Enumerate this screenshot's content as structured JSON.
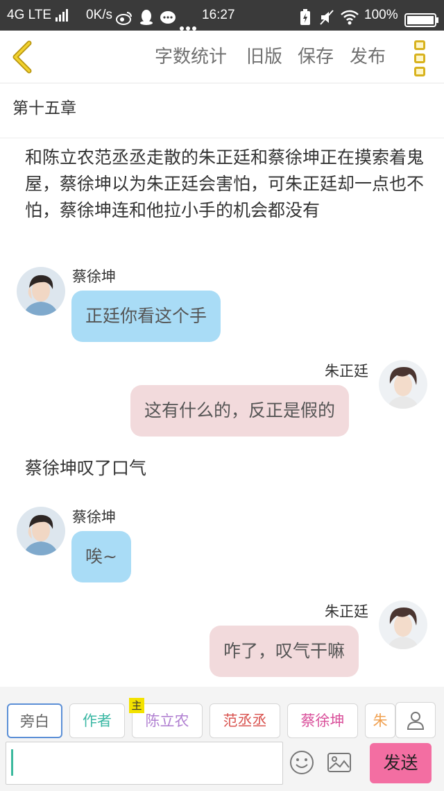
{
  "status_bar": {
    "network": "4G LTE",
    "speed": "0K/s",
    "time": "16:27",
    "battery": "100%",
    "icons": [
      "signal-icon",
      "weibo-icon",
      "qq-icon",
      "message-icon",
      "more-dots-icon",
      "charging-icon",
      "mute-icon",
      "wifi-icon",
      "battery-icon"
    ]
  },
  "nav": {
    "back_icon": "chevron-left-icon",
    "actions": [
      "字数统计",
      "旧版",
      "保存",
      "发布"
    ],
    "more_icon": "vertical-more-icon"
  },
  "chapter": {
    "title": "第十五章"
  },
  "story": {
    "narration_1": "和陈立农范丞丞走散的朱正廷和蔡徐坤正在摸索着鬼屋，蔡徐坤以为朱正廷会害怕，可朱正廷却一点也不怕，蔡徐坤连和他拉小手的机会都没有",
    "messages": [
      {
        "speaker": "蔡徐坤",
        "text": "正廷你看这个手",
        "side": "left"
      },
      {
        "speaker": "朱正廷",
        "text": "这有什么的，反正是假的",
        "side": "right"
      }
    ],
    "narration_2": "蔡徐坤叹了口气",
    "messages_2": [
      {
        "speaker": "蔡徐坤",
        "text": "唉~",
        "side": "left"
      },
      {
        "speaker": "朱正廷",
        "text": "咋了，叹气干嘛",
        "side": "right"
      }
    ]
  },
  "roles": {
    "chips": [
      {
        "label": "旁白",
        "color": "#666666"
      },
      {
        "label": "作者",
        "color": "#3bb8a4"
      },
      {
        "label": "陈立农",
        "color": "#b07fd1"
      },
      {
        "label": "范丞丞",
        "color": "#d9534f"
      },
      {
        "label": "蔡徐坤",
        "color": "#d94f9a"
      },
      {
        "label": "朱",
        "color": "#f0a050"
      }
    ],
    "main_badge": "主",
    "person_icon": "person-icon"
  },
  "composer": {
    "input_value": "",
    "emoji_icon": "smiley-icon",
    "image_icon": "image-icon",
    "send_label": "发送"
  },
  "colors": {
    "accent_yellow": "#d8b21d",
    "bubble_left": "#a9dcf6",
    "bubble_right": "#f2dadc",
    "send_button": "#f36ea2"
  }
}
